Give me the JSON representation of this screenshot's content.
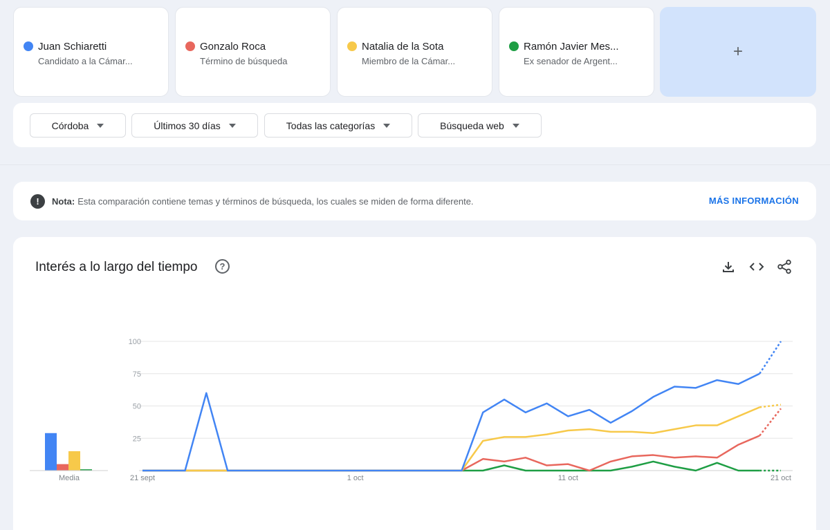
{
  "terms": [
    {
      "name": "Juan Schiaretti",
      "subtitle": "Candidato a la Cámar...",
      "color": "#4285f4"
    },
    {
      "name": "Gonzalo Roca",
      "subtitle": "Término de búsqueda",
      "color": "#e8675d"
    },
    {
      "name": "Natalia de la Sota",
      "subtitle": "Miembro de la Cámar...",
      "color": "#f7c94a"
    },
    {
      "name": "Ramón Javier Mes...",
      "subtitle": "Ex senador de Argent...",
      "color": "#1e9e44"
    }
  ],
  "add_term": {
    "label": "+"
  },
  "filters": [
    {
      "label": "Córdoba"
    },
    {
      "label": "Últimos 30 días"
    },
    {
      "label": "Todas las categorías"
    },
    {
      "label": "Búsqueda web"
    }
  ],
  "note": {
    "icon_text": "!",
    "label": "Nota:",
    "text": "Esta comparación contiene temas y términos de búsqueda, los cuales se miden de forma diferente.",
    "link": "MÁS INFORMACIÓN"
  },
  "chart_panel": {
    "title": "Interés a lo largo del tiempo",
    "help_text": "?",
    "icons": [
      "download-icon",
      "embed-code-icon",
      "share-icon"
    ]
  },
  "chart_data": {
    "type": "line",
    "x": [
      "21 sept",
      "22 sept",
      "23 sept",
      "24 sept",
      "25 sept",
      "26 sept",
      "27 sept",
      "28 sept",
      "29 sept",
      "30 sept",
      "1 oct",
      "2 oct",
      "3 oct",
      "4 oct",
      "5 oct",
      "6 oct",
      "7 oct",
      "8 oct",
      "9 oct",
      "10 oct",
      "11 oct",
      "12 oct",
      "13 oct",
      "14 oct",
      "15 oct",
      "16 oct",
      "17 oct",
      "18 oct",
      "19 oct",
      "20 oct",
      "21 oct"
    ],
    "x_tick_labels": [
      "21 sept",
      "1 oct",
      "11 oct",
      "21 oct"
    ],
    "y_ticks": [
      25,
      50,
      75,
      100
    ],
    "ylim": [
      0,
      100
    ],
    "series": [
      {
        "name": "Juan Schiaretti",
        "color": "#4285f4",
        "values": [
          0,
          0,
          0,
          60,
          0,
          0,
          0,
          0,
          0,
          0,
          0,
          0,
          0,
          0,
          0,
          0,
          45,
          55,
          45,
          52,
          42,
          47,
          37,
          46,
          57,
          65,
          64,
          70,
          67,
          75,
          100
        ]
      },
      {
        "name": "Gonzalo Roca",
        "color": "#e8675d",
        "values": [
          0,
          0,
          0,
          0,
          0,
          0,
          0,
          0,
          0,
          0,
          0,
          0,
          0,
          0,
          0,
          0,
          9,
          7,
          10,
          4,
          5,
          0,
          7,
          11,
          12,
          10,
          11,
          10,
          20,
          27,
          48
        ]
      },
      {
        "name": "Natalia de la Sota",
        "color": "#f7c94a",
        "values": [
          0,
          0,
          0,
          0,
          0,
          0,
          0,
          0,
          0,
          0,
          0,
          0,
          0,
          0,
          0,
          0,
          23,
          26,
          26,
          28,
          31,
          32,
          30,
          30,
          29,
          32,
          35,
          35,
          42,
          49,
          51
        ]
      },
      {
        "name": "Ramón Javier Mes...",
        "color": "#1e9e44",
        "values": [
          0,
          0,
          0,
          0,
          0,
          0,
          0,
          0,
          0,
          0,
          0,
          0,
          0,
          0,
          0,
          0,
          0,
          4,
          0,
          0,
          0,
          0,
          0,
          3,
          7,
          3,
          0,
          6,
          0,
          0,
          0
        ]
      }
    ],
    "partial_last_point": true,
    "averages": {
      "label": "Media",
      "values": [
        29,
        5,
        15,
        1
      ]
    },
    "grid": true
  }
}
